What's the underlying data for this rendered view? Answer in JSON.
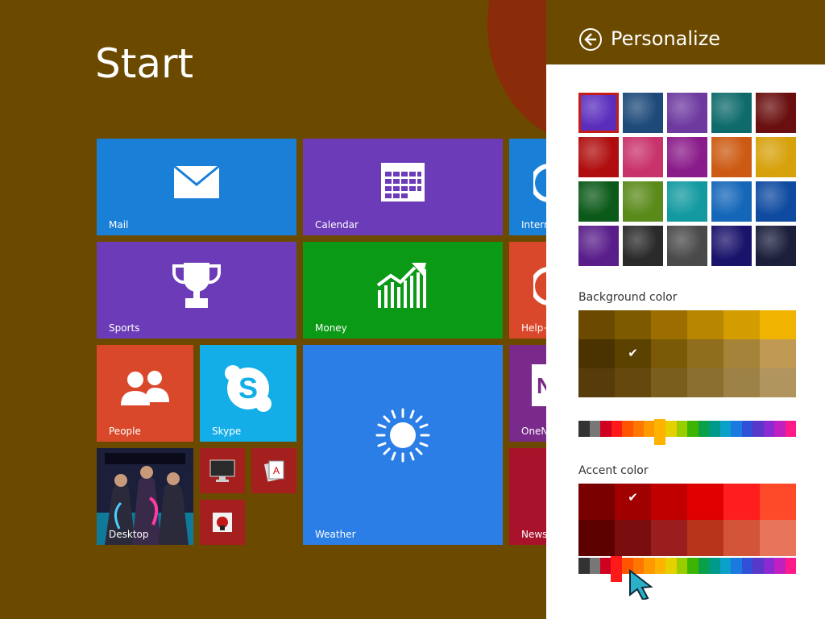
{
  "start": {
    "title": "Start",
    "background": "#6b4a00"
  },
  "tiles": {
    "mail": {
      "label": "Mail",
      "color": "#1a7fd6",
      "icon": "mail-icon"
    },
    "calendar": {
      "label": "Calendar",
      "color": "#6b3bb8",
      "icon": "calendar-icon"
    },
    "internet": {
      "label": "Interne",
      "color": "#1a7fd6",
      "icon": "internet-explorer-icon"
    },
    "sports": {
      "label": "Sports",
      "color": "#6b3bb8",
      "icon": "trophy-icon"
    },
    "money": {
      "label": "Money",
      "color": "#0a9a16",
      "icon": "chart-icon"
    },
    "help": {
      "label": "Help+",
      "color": "#d9482b",
      "icon": "help-icon"
    },
    "people": {
      "label": "People",
      "color": "#d9482b",
      "icon": "people-icon"
    },
    "skype": {
      "label": "Skype",
      "color": "#13aee8",
      "icon": "skype-icon"
    },
    "weather": {
      "label": "Weather",
      "color": "#2b7ee6",
      "icon": "sun-icon"
    },
    "onenote": {
      "label": "OneN",
      "color": "#7a2a8a",
      "icon": "onenote-icon"
    },
    "desktop": {
      "label": "Desktop",
      "color": "#1b1f3a",
      "icon": "desktop-wallpaper"
    },
    "news": {
      "label": "News",
      "color": "#a8122a",
      "icon": "news-icon"
    },
    "small_monitor": {
      "color": "#a51f1f",
      "icon": "monitor-icon"
    },
    "small_cards": {
      "color": "#a51f1f",
      "icon": "cards-icon"
    },
    "small_app": {
      "color": "#a51f1f",
      "icon": "app-icon"
    }
  },
  "panel": {
    "title": "Personalize",
    "background_section": "Background color",
    "accent_section": "Accent color",
    "background_selected": "#6b4a00",
    "accent_selected": "#c51d16"
  },
  "thumbnails": [
    {
      "name": "thumb-purple-swirl",
      "color": "#5a2dbd",
      "selected": true
    },
    {
      "name": "thumb-robot-blue",
      "color": "#1e4a7a"
    },
    {
      "name": "thumb-castle-purple",
      "color": "#6e3aa0"
    },
    {
      "name": "thumb-teal-swirl",
      "color": "#0f6b6b"
    },
    {
      "name": "thumb-red-flower",
      "color": "#6a0f0f"
    },
    {
      "name": "thumb-red-eye",
      "color": "#b00e0e"
    },
    {
      "name": "thumb-pink-bird",
      "color": "#c8336b"
    },
    {
      "name": "thumb-pink-flower",
      "color": "#8a1b8a"
    },
    {
      "name": "thumb-orange-snail",
      "color": "#cc5a12"
    },
    {
      "name": "thumb-yellow-bird",
      "color": "#d7a10b"
    },
    {
      "name": "thumb-green-leaf",
      "color": "#0c5a1a"
    },
    {
      "name": "thumb-green-owl",
      "color": "#5a8a1a"
    },
    {
      "name": "thumb-teal-star",
      "color": "#129aa0"
    },
    {
      "name": "thumb-blue-bird",
      "color": "#1466b8"
    },
    {
      "name": "thumb-blue-waves",
      "color": "#0e4aa0"
    },
    {
      "name": "thumb-purple-ornament",
      "color": "#5a1e8a"
    },
    {
      "name": "thumb-fireworks",
      "color": "#2a2a2a"
    },
    {
      "name": "thumb-gray-pattern",
      "color": "#4a4a4a"
    },
    {
      "name": "thumb-navy-solid",
      "color": "#1a136b"
    },
    {
      "name": "thumb-band-photo",
      "color": "#1b1f3a"
    }
  ],
  "background_grid": [
    "#6b4a00",
    "#7d5a00",
    "#9c6e00",
    "#b88600",
    "#d39d00",
    "#f0b400",
    "#4a3300",
    "#5c4200",
    "#7a5a06",
    "#8f6e1e",
    "#a5843a",
    "#c09a54",
    "#553c0a",
    "#64480e",
    "#7a5e1e",
    "#8b6f30",
    "#9c8246",
    "#b0965e"
  ],
  "background_checked_index": 7,
  "accent_grid": [
    "#7a0000",
    "#a00000",
    "#c00000",
    "#e00000",
    "#ff1e1e",
    "#ff4a2a",
    "#5c0000",
    "#7a0e0e",
    "#9a1e1e",
    "#b8341a",
    "#d4543a",
    "#e8745a"
  ],
  "accent_checked_index": 1,
  "hue_colors": [
    "#333333",
    "#777777",
    "#d00020",
    "#ff1a1a",
    "#ff5500",
    "#ff7700",
    "#ff9900",
    "#ffb300",
    "#e6d000",
    "#9acd00",
    "#3cb400",
    "#0aa04a",
    "#009a8a",
    "#0aa0c8",
    "#1a7ae0",
    "#3050d8",
    "#5838c8",
    "#8a2ad0",
    "#c020c0",
    "#ff1a8a"
  ],
  "background_hue_index": 7,
  "accent_hue_index": 3
}
